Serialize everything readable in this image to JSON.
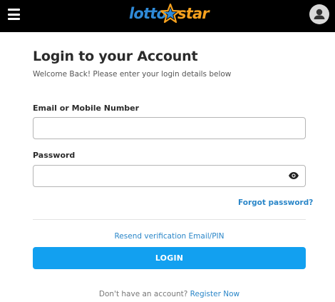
{
  "header": {
    "logo_left": "lotto",
    "logo_right": "star",
    "menu_icon": "hamburger-menu-icon",
    "avatar_icon": "user-icon"
  },
  "login": {
    "title": "Login to your Account",
    "subtitle": "Welcome Back! Please enter your login details below",
    "email_label": "Email or Mobile Number",
    "email_value": "",
    "email_placeholder": "",
    "password_label": "Password",
    "password_value": "",
    "password_placeholder": "",
    "forgot_password": "Forgot password?",
    "resend_verification": "Resend verification Email/PIN",
    "login_button": "LOGIN",
    "no_account_text": "Don't have an account?",
    "register_link": "Register Now"
  },
  "colors": {
    "header_bg": "#000000",
    "brand_blue": "#2f8ad8",
    "brand_orange": "#f6a11e",
    "button_blue": "#12a0f0",
    "link_blue": "#2a86c8"
  }
}
